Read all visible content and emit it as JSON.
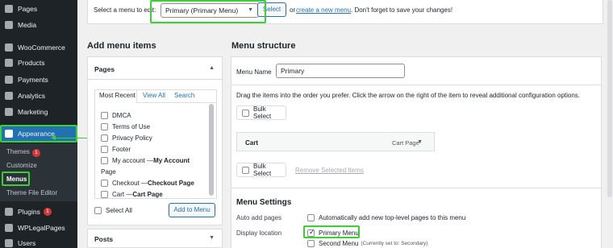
{
  "sidebar": {
    "items": [
      {
        "label": "Pages",
        "icon": "pages-icon"
      },
      {
        "label": "Media",
        "icon": "media-icon"
      },
      {
        "label": "WooCommerce",
        "icon": "woocommerce-icon"
      },
      {
        "label": "Products",
        "icon": "products-icon"
      },
      {
        "label": "Payments",
        "icon": "payments-icon"
      },
      {
        "label": "Analytics",
        "icon": "analytics-icon"
      },
      {
        "label": "Marketing",
        "icon": "marketing-icon"
      },
      {
        "label": "Appearance",
        "icon": "appearance-icon"
      },
      {
        "label": "Plugins",
        "icon": "plugins-icon",
        "badge": "1"
      },
      {
        "label": "WPLegalPages",
        "icon": "wplegalpages-icon"
      },
      {
        "label": "Users",
        "icon": "users-icon"
      }
    ],
    "submenu": [
      {
        "label": "Themes",
        "badge": "1"
      },
      {
        "label": "Customize"
      },
      {
        "label": "Menus"
      },
      {
        "label": "Theme File Editor"
      }
    ]
  },
  "topbar": {
    "select_label": "Select a menu to edit:",
    "selected_menu": "Primary (Primary Menu)",
    "select_button": "Select",
    "or": "or",
    "create_link": "create a new menu",
    "after_text": ". Don't forget to save your changes!"
  },
  "add_items": {
    "heading": "Add menu items",
    "pages_title": "Pages",
    "tabs": [
      "Most Recent",
      "View All",
      "Search"
    ],
    "pages": [
      {
        "name": "DMCA",
        "suffix": ""
      },
      {
        "name": "Terms of Use",
        "suffix": ""
      },
      {
        "name": "Privacy Policy",
        "suffix": ""
      },
      {
        "name": "Footer",
        "suffix": ""
      },
      {
        "name": "My account — ",
        "suffix": "My Account"
      },
      {
        "name": "Page",
        "suffix": ""
      },
      {
        "name": "Checkout — ",
        "suffix": "Checkout Page"
      },
      {
        "name": "Cart — ",
        "suffix": "Cart Page"
      }
    ],
    "select_all": "Select All",
    "add_button": "Add to Menu",
    "posts_title": "Posts"
  },
  "structure": {
    "heading": "Menu structure",
    "menu_name_label": "Menu Name",
    "menu_name_value": "Primary",
    "instructions": "Drag the items into the order you prefer. Click the arrow on the right of the item to reveal additional configuration options.",
    "bulk_select": "Bulk Select",
    "items": [
      {
        "title": "Cart",
        "type": "Cart Page"
      }
    ],
    "remove_selected": "Remove Selected Items",
    "settings_heading": "Menu Settings",
    "auto_add_label": "Auto add pages",
    "auto_add_option": "Automatically add new top-level pages to this menu",
    "display_location_label": "Display location",
    "locations": [
      {
        "label": "Primary Menu",
        "note": "",
        "checked": true
      },
      {
        "label": "Second Menu",
        "note": "(Currently set to: Secondary)",
        "checked": false
      }
    ]
  },
  "colors": {
    "accent": "#2271b1",
    "highlight": "#3cd035",
    "sidebar": "#1d2327"
  }
}
